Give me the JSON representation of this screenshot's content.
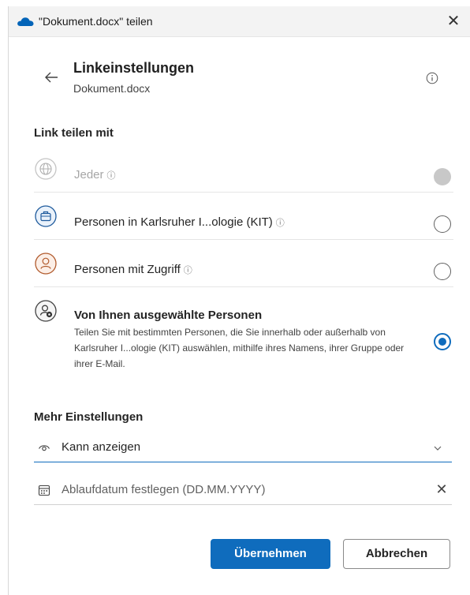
{
  "window": {
    "title": "\"Dokument.docx\" teilen",
    "close_symbol": "✕"
  },
  "header": {
    "title": "Linkeinstellungen",
    "subtitle": "Dokument.docx"
  },
  "share_section": {
    "label": "Link teilen mit",
    "options": [
      {
        "label": "Jeder",
        "info": "ⓘ",
        "state": "disabled"
      },
      {
        "label": "Personen in Karlsruher I...ologie (KIT)",
        "info": "ⓘ",
        "state": "unchecked"
      },
      {
        "label": "Personen mit Zugriff",
        "info": "ⓘ",
        "state": "unchecked"
      },
      {
        "label": "Von Ihnen ausgewählte Personen",
        "description": "Teilen Sie mit bestimmten Personen, die Sie innerhalb oder außerhalb von Karlsruher I...ologie (KIT) auswählen, mithilfe ihres Namens, ihrer Gruppe oder ihrer E-Mail.",
        "state": "checked"
      }
    ]
  },
  "more_settings": {
    "label": "Mehr Einstellungen",
    "permission_value": "Kann anzeigen",
    "expiry_placeholder": "Ablaufdatum festlegen (DD.MM.YYYY)",
    "clear_symbol": "✕"
  },
  "buttons": {
    "apply": "Übernehmen",
    "cancel": "Abbrechen"
  },
  "colors": {
    "accent": "#0f6cbd",
    "org_icon": "#1e5a9c",
    "people_icon": "#b15a2c"
  },
  "icons": [
    "onedrive-cloud-icon",
    "back-arrow-icon",
    "info-icon",
    "globe-icon",
    "briefcase-icon",
    "person-icon",
    "people-gear-icon",
    "eye-icon",
    "chevron-down-icon",
    "calendar-icon",
    "close-icon"
  ]
}
